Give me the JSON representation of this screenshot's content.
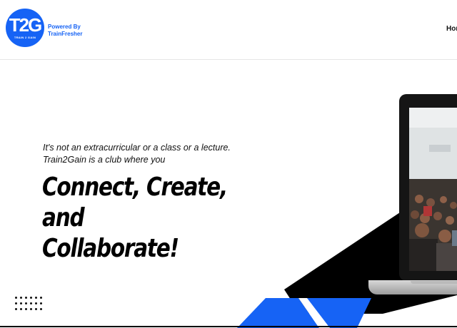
{
  "header": {
    "logo": {
      "letters": "T2G",
      "subtitle": "TRAIN 2 GAIN",
      "color": "#1663f5"
    },
    "powered_by_line1": "Powered By",
    "powered_by_line2": "TrainFresher",
    "nav": {
      "home_label_visible": "Hom"
    }
  },
  "hero": {
    "tagline_line1": "It's not an extracurricular or a class or a lecture.",
    "tagline_line2": "Train2Gain is a club where you",
    "headline_line1": "Connect, Create, and",
    "headline_line2": "Collaborate!",
    "accent_color": "#1663f5",
    "image_description_icon": "laptop-photo"
  }
}
